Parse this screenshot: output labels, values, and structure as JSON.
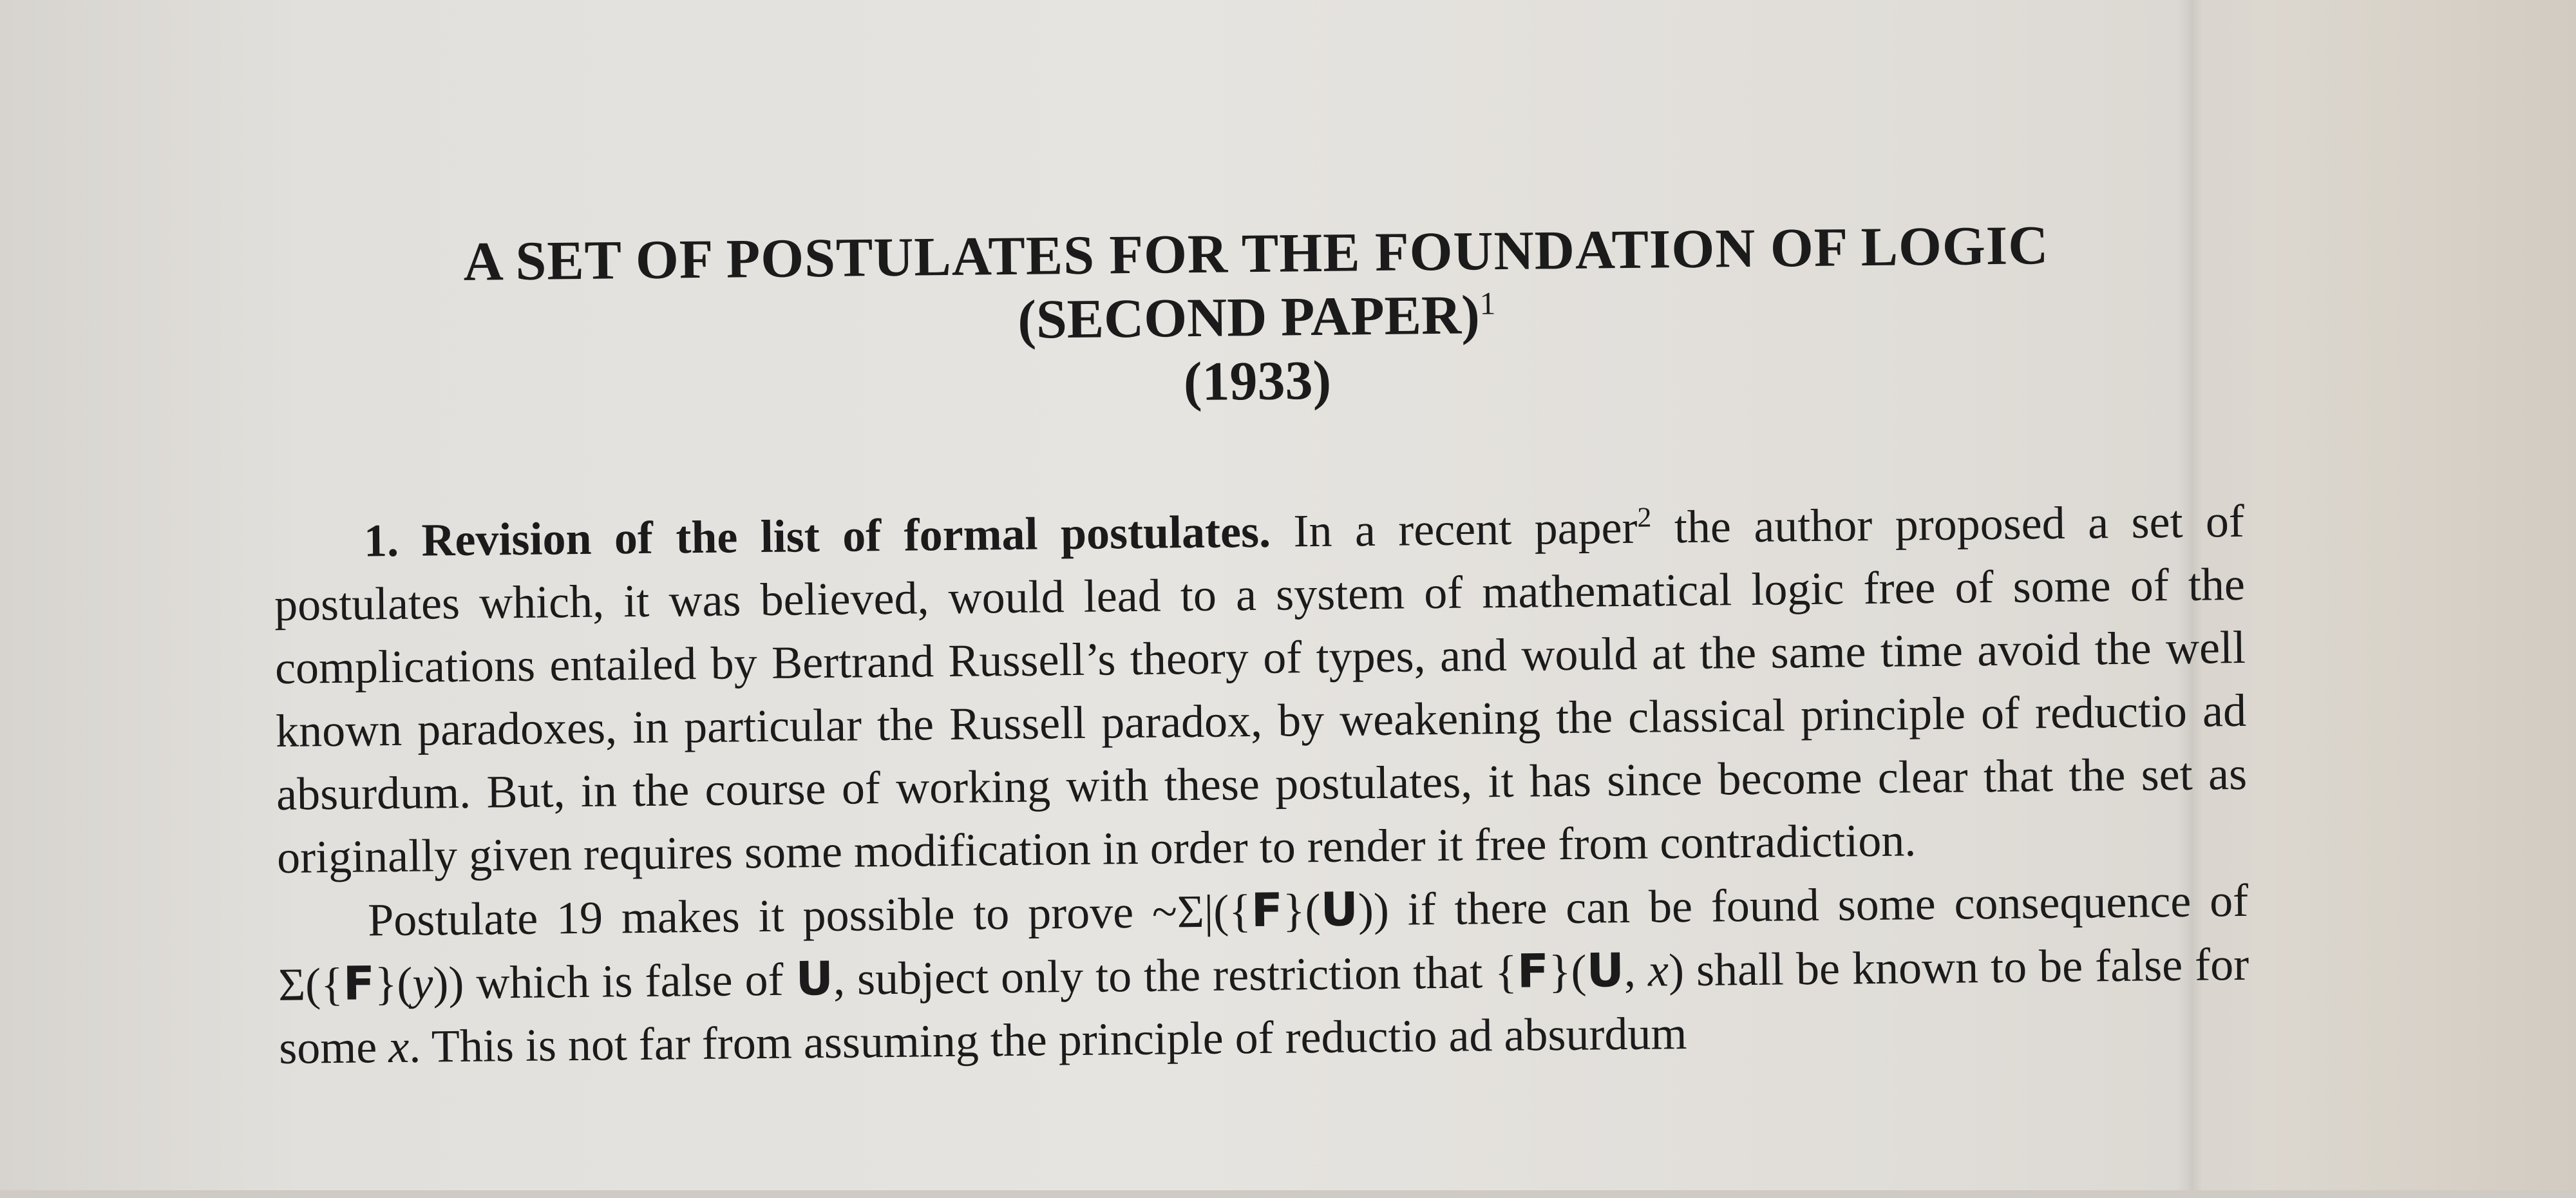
{
  "title": {
    "line1": "A SET OF POSTULATES FOR THE FOUNDATION OF LOGIC",
    "line2": "(SECOND PAPER)",
    "line2_footnote": "1",
    "line3": "(1933)"
  },
  "section1": {
    "number": "1.",
    "heading": "Revision of the list of formal postulates.",
    "p1_a": " In a recent paper",
    "p1_footnote": "2",
    "p1_b": " the author proposed a set of postulates which, it was believed, would lead to a system of mathematical logic free of some of the complications entailed by Bertrand Russell’s theory of types, and would at the same time avoid the well known paradoxes, in particular the Russell paradox, by weakening the classical principle of reductio ad absurdum. But, in the course of working with these postulates, it has since become clear that the set as originally given requires some modification in order to render it free from contradiction.",
    "p2_a": "Postulate 19 makes it possible to prove ~Σ|({",
    "p2_F1": "F",
    "p2_b": "}(",
    "p2_U1": "U",
    "p2_c": ")) if there can be found some consequence of Σ({",
    "p2_F2": "F",
    "p2_d": "}(",
    "p2_y": "y",
    "p2_e": ")) which is false of ",
    "p2_U2": "U",
    "p2_f": ", subject only to the restriction that {",
    "p2_F3": "F",
    "p2_g": "}(",
    "p2_U3": "U",
    "p2_h": ", ",
    "p2_x1": "x",
    "p2_i": ") shall be known to be false for some ",
    "p2_x2": "x",
    "p2_j": ". This is not far from assuming the principle of reductio ad absurdum"
  }
}
